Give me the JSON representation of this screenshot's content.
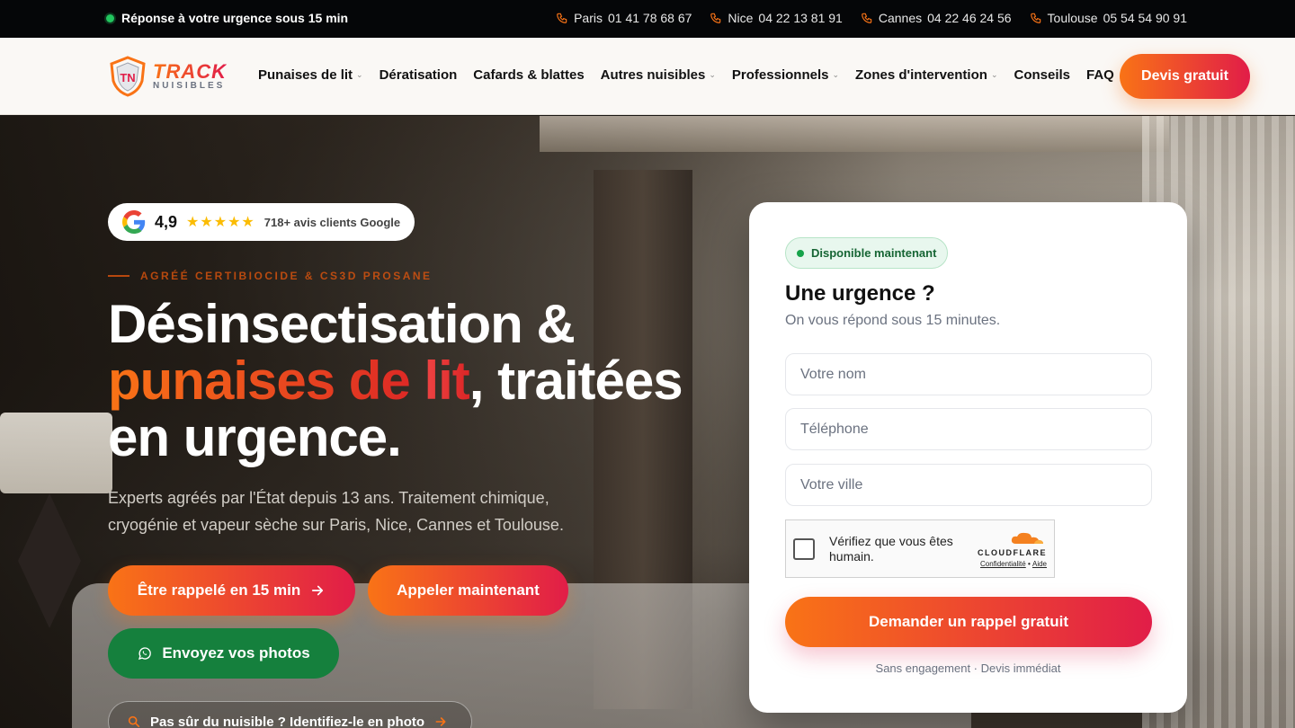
{
  "topbar": {
    "urgent_text": "Réponse à votre urgence sous 15 min",
    "phones": [
      {
        "city": "Paris",
        "number": "01 41 78 68 67"
      },
      {
        "city": "Nice",
        "number": "04 22 13 81 91"
      },
      {
        "city": "Cannes",
        "number": "04 22 46 24 56"
      },
      {
        "city": "Toulouse",
        "number": "05 54 54 90 91"
      }
    ]
  },
  "brand": {
    "name": "TRACK",
    "sub": "NUISIBLES",
    "colors": {
      "accent_start": "#f97316",
      "accent_end": "#e11d48",
      "green": "#15803d"
    }
  },
  "nav": {
    "items": [
      {
        "label": "Punaises de lit",
        "dropdown": true
      },
      {
        "label": "Dératisation",
        "dropdown": false
      },
      {
        "label": "Cafards & blattes",
        "dropdown": false
      },
      {
        "label": "Autres nuisibles",
        "dropdown": true
      },
      {
        "label": "Professionnels",
        "dropdown": true
      },
      {
        "label": "Zones d'intervention",
        "dropdown": true
      },
      {
        "label": "Conseils",
        "dropdown": false
      },
      {
        "label": "FAQ",
        "dropdown": false
      }
    ],
    "cta_label": "Devis gratuit"
  },
  "hero": {
    "rating": {
      "score": "4,9",
      "stars": "★★★★★",
      "reviews": "718+ avis clients Google"
    },
    "eyebrow": "AGRÉÉ CERTIBIOCIDE & CS3D PROSANE",
    "headline_1": "Désinsectisation &",
    "headline_highlight_a": "punaises de ",
    "headline_highlight_b": "lit",
    "headline_2": ", traitées",
    "headline_3": "en urgence.",
    "lead": "Experts agréés par l'État depuis 13 ans. Traitement chimique, cryogénie et vapeur sèche sur Paris, Nice, Cannes et Toulouse.",
    "btn_callback": "Être rappelé en 15 min",
    "btn_call": "Appeler maintenant",
    "btn_whatsapp": "Envoyez vos photos",
    "identify": "Pas sûr du nuisible ? Identifiez-le en photo"
  },
  "form": {
    "badge": "Disponible maintenant",
    "title": "Une urgence ?",
    "subtitle": "On vous répond sous 15 minutes.",
    "name_placeholder": "Votre nom",
    "phone_placeholder": "Téléphone",
    "city_placeholder": "Votre ville",
    "captcha_label": "Vérifiez que vous êtes humain.",
    "captcha_brand": "CLOUDFLARE",
    "captcha_privacy": "Confidentialité",
    "captcha_sep": " • ",
    "captcha_help": "Aide",
    "submit": "Demander un rappel gratuit",
    "note": "Sans engagement · Devis immédiat"
  }
}
